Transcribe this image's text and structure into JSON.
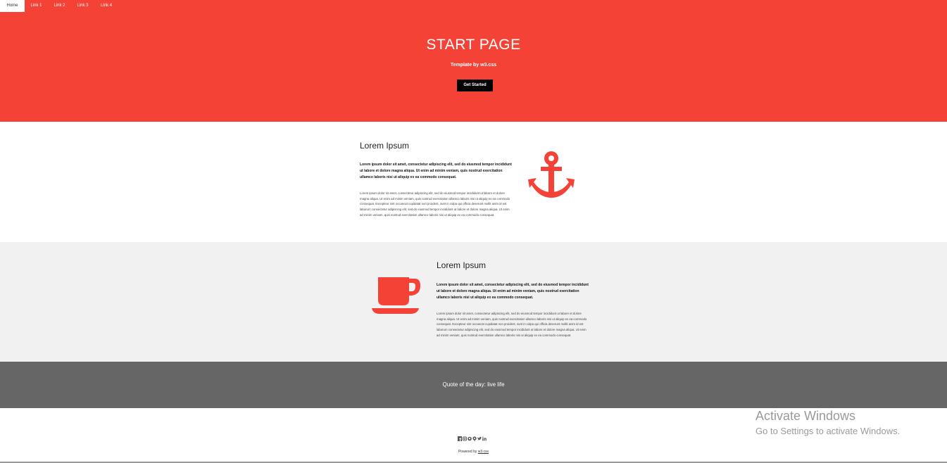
{
  "nav": {
    "items": [
      {
        "label": "Home",
        "active": true
      },
      {
        "label": "Link 1"
      },
      {
        "label": "Link 2"
      },
      {
        "label": "Link 3"
      },
      {
        "label": "Link 4"
      }
    ]
  },
  "hero": {
    "title": "START PAGE",
    "subtitle": "Template by w3.css",
    "button_label": "Get Started"
  },
  "section1": {
    "title": "Lorem Ipsum",
    "lead": "Lorem ipsum dolor sit amet, consectetur adipiscing elit, sed do eiusmod tempor incididunt ut labore et dolore magna aliqua. Ut enim ad minim veniam, quis nostrud exercitation ullamco laboris nisi ut aliquip ex ea commodo consequat.",
    "body": "Lorem ipsum dolor sit amet, consectetur adipiscing elit, sed do eiusmod tempor incididunt ut labore et dolore magna aliqua. Ut enim ad minim veniam, quis nostrud exercitation ullamco laboris nisi ut aliquip ex ea commodo consequat. Excepteur sint occaecat cupidatat non proident, sunt in culpa qui officia deserunt mollit anim id est laborum consectetur adipiscing elit, sed do eiusmod tempor incididunt ut labore et dolore magna aliqua. Ut enim ad minim veniam, quis nostrud exercitation ullamco laboris nisi ut aliquip ex ea commodo consequat.",
    "icon": "anchor-icon"
  },
  "section2": {
    "title": "Lorem Ipsum",
    "lead": "Lorem ipsum dolor sit amet, consectetur adipiscing elit, sed do eiusmod tempor incididunt ut labore et dolore magna aliqua. Ut enim ad minim veniam, quis nostrud exercitation ullamco laboris nisi ut aliquip ex ea commodo consequat.",
    "body": "Lorem ipsum dolor sit amet, consectetur adipiscing elit, sed do eiusmod tempor incididunt ut labore et dolore magna aliqua. Ut enim ad minim veniam, quis nostrud exercitation ullamco laboris nisi ut aliquip ex ea commodo consequat. Excepteur sint occaecat cupidatat non proident, sunt in culpa qui officia deserunt mollit anim id est laborum consectetur adipiscing elit, sed do eiusmod tempor incididunt ut labore et dolore magna aliqua. Ut enim ad minim veniam, quis nostrud exercitation ullamco laboris nisi ut aliquip ex ea commodo consequat.",
    "icon": "coffee-icon"
  },
  "quote": {
    "text": "Quote of the day: live life"
  },
  "footer": {
    "social_icons": [
      "facebook-icon",
      "instagram-icon",
      "snapchat-icon",
      "pinterest-icon",
      "twitter-icon",
      "linkedin-icon"
    ],
    "powered_prefix": "Powered by ",
    "powered_link": "w3.css"
  },
  "overlay": {
    "title": "Activate Windows",
    "subtitle": "Go to Settings to activate Windows."
  },
  "colors": {
    "accent": "#f44336",
    "light_section": "#f1f1f1",
    "quote_bg": "#666666"
  }
}
